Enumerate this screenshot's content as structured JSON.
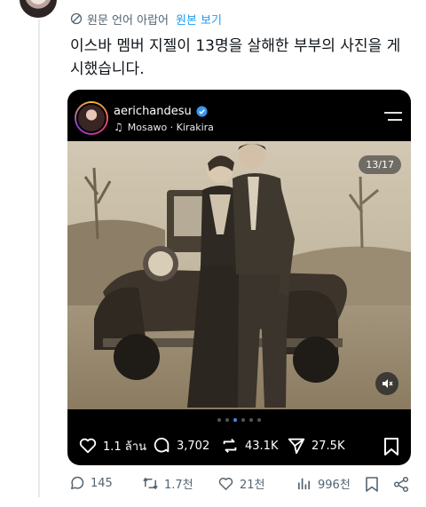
{
  "tweet": {
    "translate_label": "원문 언어 아랍어",
    "translate_link": "원본 보기",
    "text": "이스바 멤버 지젤이 13명을 살해한 부부의 사진을 게시했습니다."
  },
  "instagram": {
    "username": "aerichandesu",
    "music": "Mosawo · Kirakira",
    "counter": "13/17",
    "likes": "1.1 ล้าน",
    "comments": "3,702",
    "reposts": "43.1K",
    "shares": "27.5K",
    "carousel_dots": 6,
    "active_dot": 2
  },
  "actions": {
    "replies": "145",
    "retweets": "1.7천",
    "likes": "21천",
    "views": "996천"
  },
  "colors": {
    "link_blue": "#1d9bf0",
    "muted_gray": "#536471",
    "card_black": "#000000",
    "active_dot": "#3f86f0"
  }
}
